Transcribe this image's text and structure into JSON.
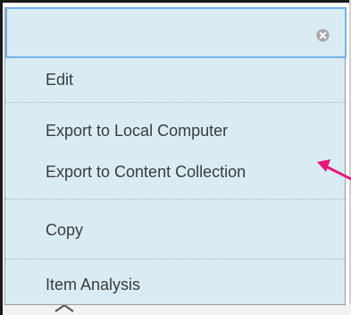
{
  "menu": {
    "search": {
      "value": "",
      "placeholder": ""
    },
    "items": [
      {
        "label": "Edit"
      },
      {
        "label": "Export to Local Computer"
      },
      {
        "label": "Export to Content Collection"
      },
      {
        "label": "Copy"
      },
      {
        "label": "Item Analysis"
      }
    ]
  },
  "icons": {
    "clear": "close-circle-icon",
    "annotation": "arrow-pointer-icon"
  },
  "colors": {
    "menu_background": "#d9ecf3",
    "search_border": "#77b1e9",
    "annotation_arrow": "#e8157a",
    "text": "#3b3b3b"
  }
}
